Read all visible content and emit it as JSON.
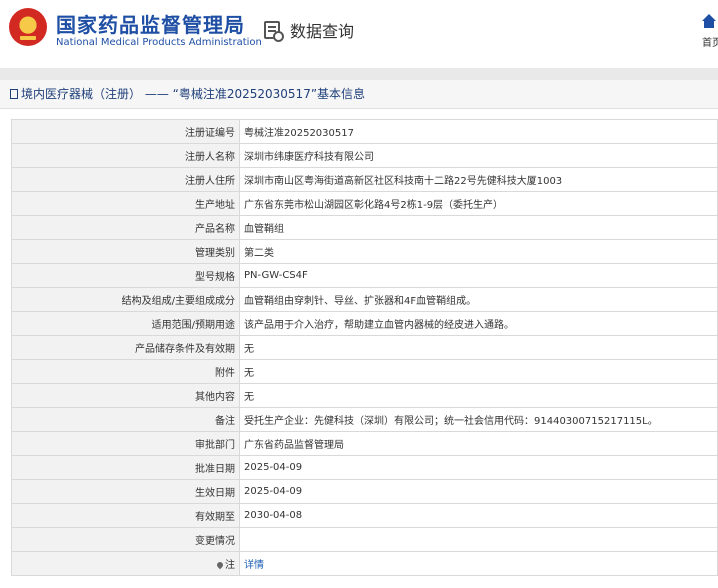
{
  "header": {
    "title_cn": "国家药品监督管理局",
    "title_en": "National Medical Products Administration",
    "query_label": "数据查询",
    "home_label": "首页"
  },
  "breadcrumb": "境内医疗器械（注册） —— “粤械注准20252030517”基本信息",
  "rows": [
    {
      "label": "注册证编号",
      "value": "粤械注准20252030517"
    },
    {
      "label": "注册人名称",
      "value": "深圳市纬康医疗科技有限公司"
    },
    {
      "label": "注册人住所",
      "value": "深圳市南山区粤海街道高新区社区科技南十二路22号先健科技大厦1003"
    },
    {
      "label": "生产地址",
      "value": "广东省东莞市松山湖园区彰化路4号2栋1-9层（委托生产）"
    },
    {
      "label": "产品名称",
      "value": "血管鞘组"
    },
    {
      "label": "管理类别",
      "value": "第二类"
    },
    {
      "label": "型号规格",
      "value": "PN-GW-CS4F"
    },
    {
      "label": "结构及组成/主要组成成分",
      "value": "血管鞘组由穿刺针、导丝、扩张器和4F血管鞘组成。"
    },
    {
      "label": "适用范围/预期用途",
      "value": "该产品用于介入治疗，帮助建立血管内器械的经皮进入通路。"
    },
    {
      "label": "产品储存条件及有效期",
      "value": "无"
    },
    {
      "label": "附件",
      "value": "无"
    },
    {
      "label": "其他内容",
      "value": "无"
    },
    {
      "label": "备注",
      "value": "受托生产企业：先健科技（深圳）有限公司；统一社会信用代码：91440300715217115L。"
    },
    {
      "label": "审批部门",
      "value": "广东省药品监督管理局"
    },
    {
      "label": "批准日期",
      "value": "2025-04-09"
    },
    {
      "label": "生效日期",
      "value": "2025-04-09"
    },
    {
      "label": "有效期至",
      "value": "2030-04-08"
    },
    {
      "label": "变更情况",
      "value": ""
    }
  ],
  "note_row": {
    "label": "注",
    "link": "详情",
    "icon": "pin-icon"
  }
}
